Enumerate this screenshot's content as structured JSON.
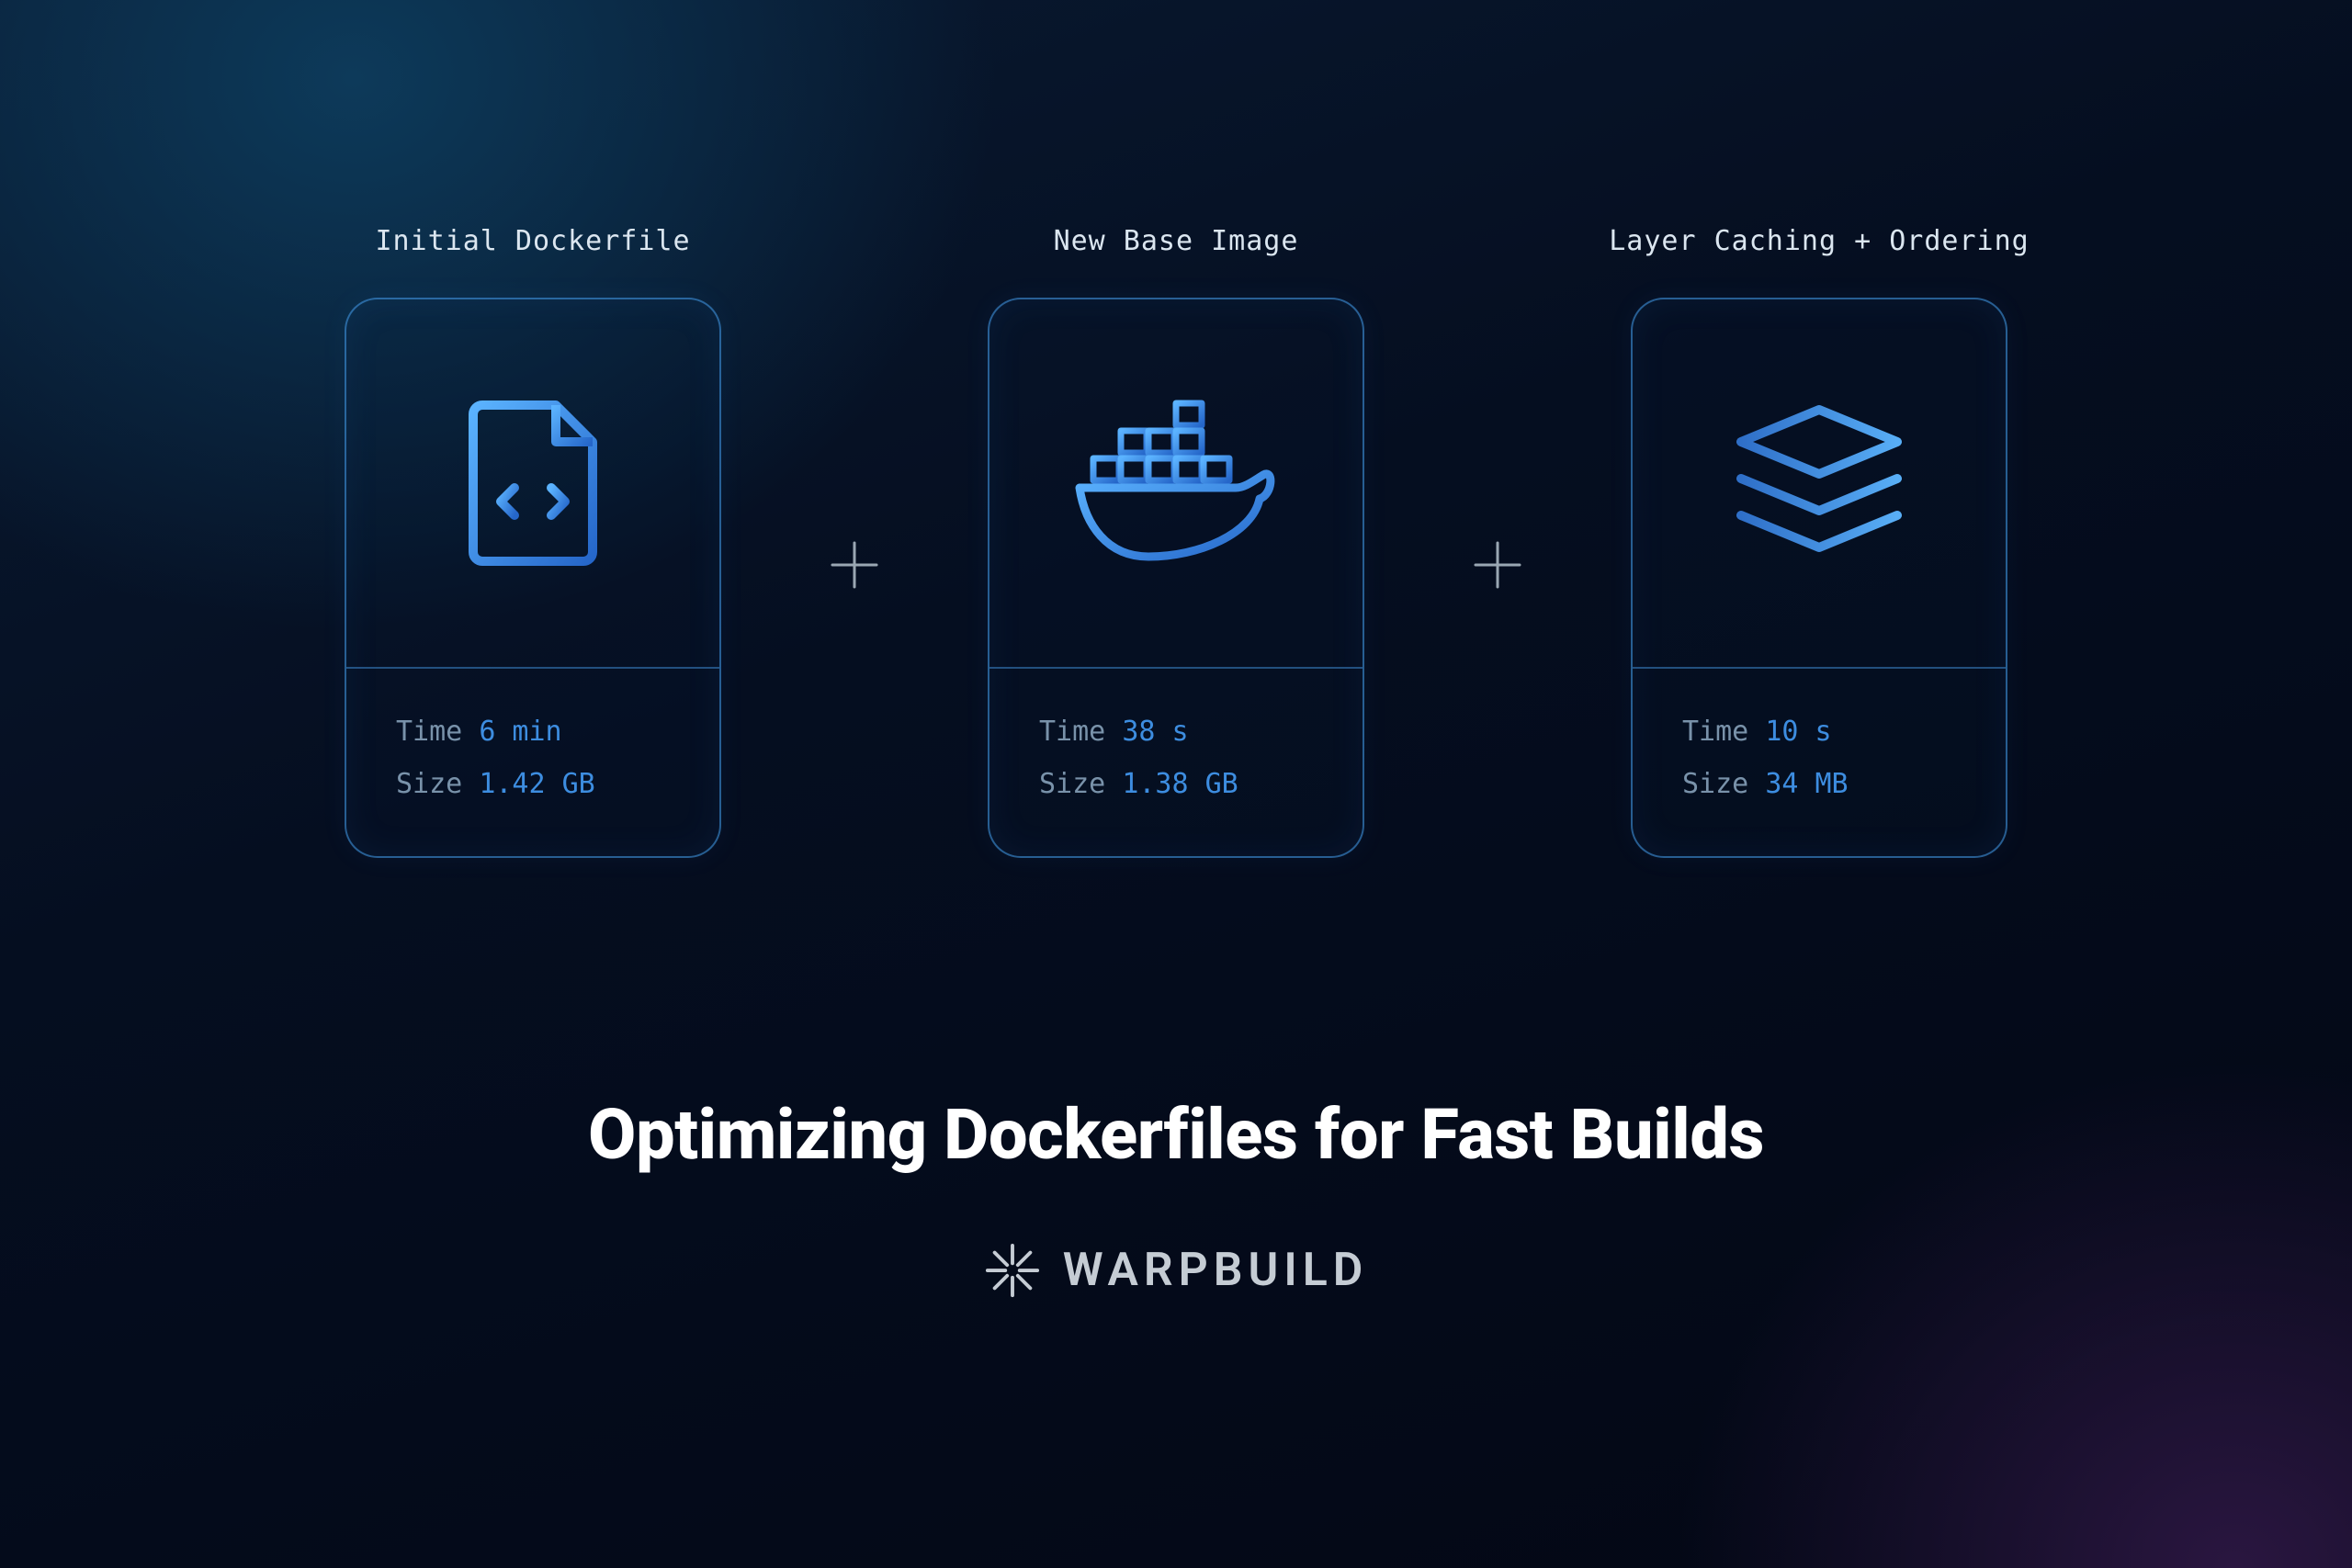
{
  "headline": "Optimizing Dockerfiles for Fast Builds",
  "brand": "WARPBUILD",
  "labels": {
    "time": "Time",
    "size": "Size",
    "plus": "+"
  },
  "cards": [
    {
      "title": "Initial Dockerfile",
      "icon": "file-code-icon",
      "time": "6 min",
      "size": "1.42 GB"
    },
    {
      "title": "New Base Image",
      "icon": "docker-icon",
      "time": "38 s",
      "size": "1.38 GB"
    },
    {
      "title": "Layer Caching + Ordering",
      "icon": "layers-icon",
      "time": "10 s",
      "size": "34 MB"
    }
  ]
}
